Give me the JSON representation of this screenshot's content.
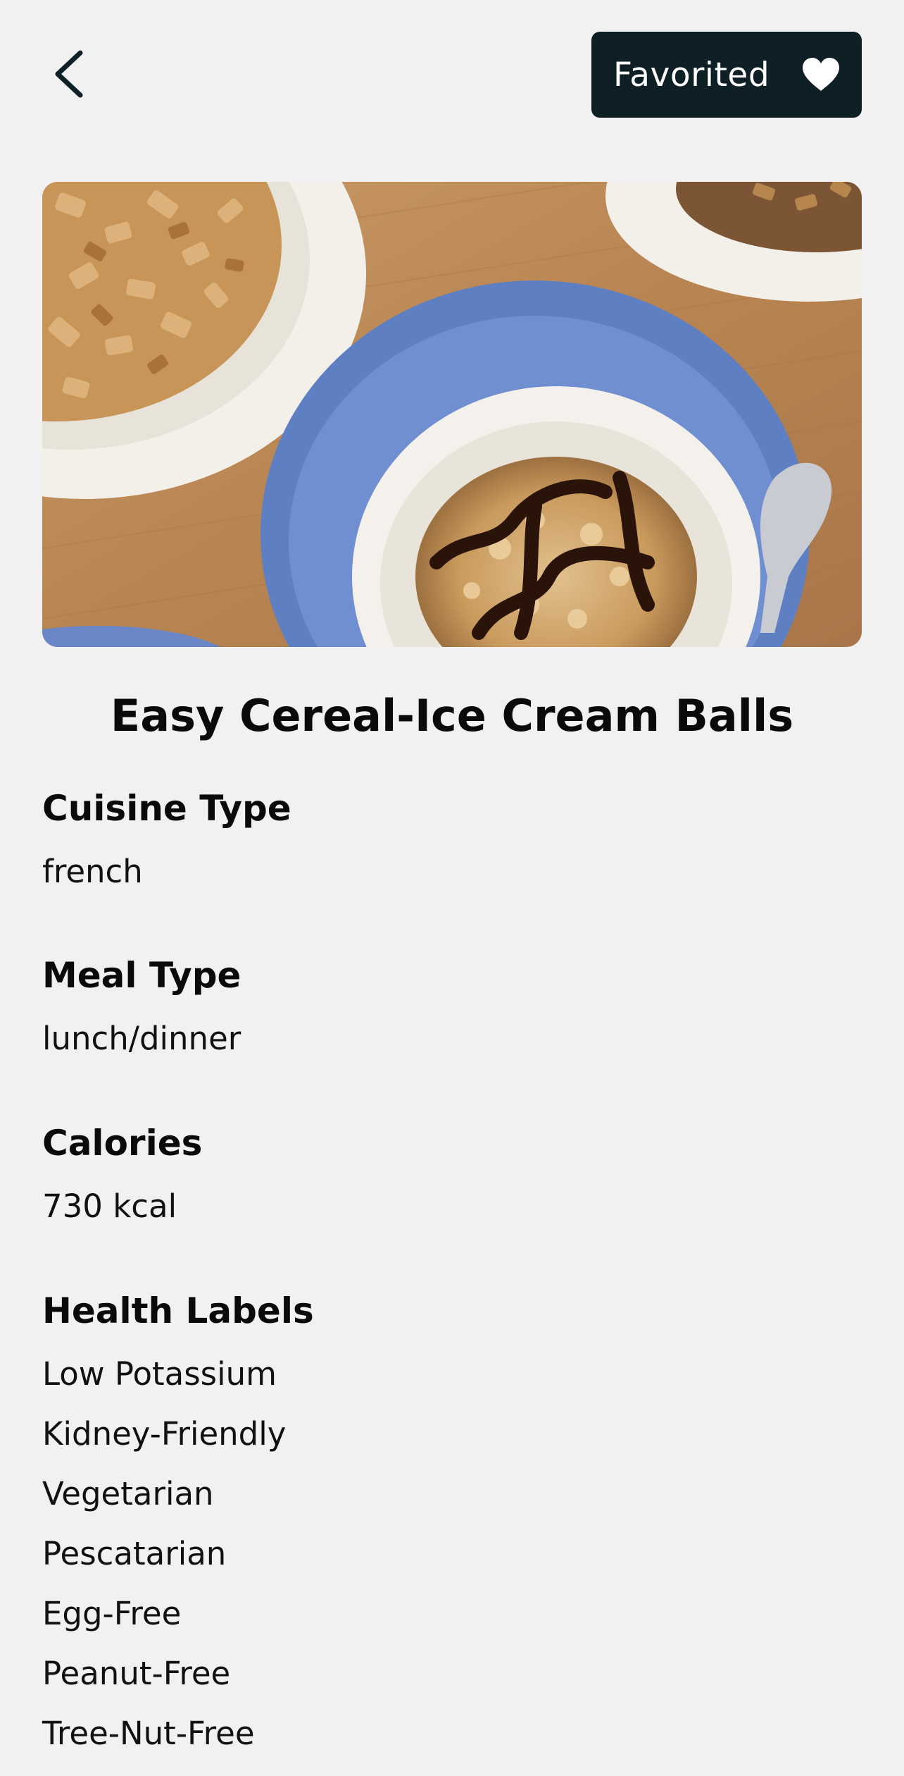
{
  "header": {
    "back_icon": "chevron-left-icon",
    "favorite_label": "Favorited",
    "favorite_icon": "heart-icon",
    "favorite_bg_color": "#0e1f26"
  },
  "recipe": {
    "title": "Easy Cereal-Ice Cream Balls",
    "image_alt": "cereal-coated ice cream ball with chocolate sauce in a bowl"
  },
  "sections": {
    "cuisine": {
      "heading": "Cuisine Type",
      "value": "french"
    },
    "meal": {
      "heading": "Meal Type",
      "value": "lunch/dinner"
    },
    "calories": {
      "heading": "Calories",
      "value": "730 kcal"
    },
    "health": {
      "heading": "Health Labels",
      "items": [
        "Low Potassium",
        "Kidney-Friendly",
        "Vegetarian",
        "Pescatarian",
        "Egg-Free",
        "Peanut-Free",
        "Tree-Nut-Free"
      ]
    }
  }
}
